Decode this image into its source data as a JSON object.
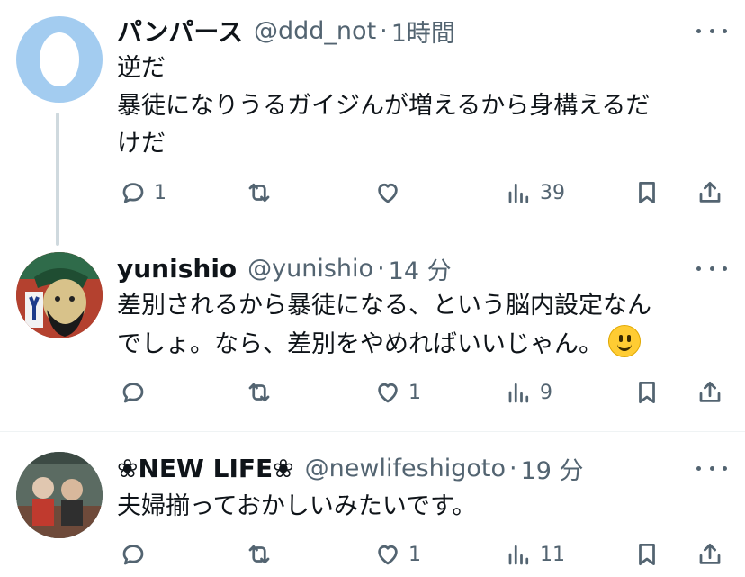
{
  "tweets": [
    {
      "name": "パンパース",
      "handle": "@ddd_not",
      "time": "1時間",
      "text": "逆だ\n暴徒になりうるガイジんが増えるから身構えるだ\nけだ",
      "replies": "1",
      "reposts": "",
      "likes": "",
      "views": "39",
      "avatar": "egg"
    },
    {
      "name": "yunishio",
      "handle": "@yunishio",
      "time": "14 分",
      "text": "差別されるから暴徒になる、という脳内設定なん\nでしょ。なら、差別をやめればいいじゃん。",
      "emoji": "slightly-smiling-face",
      "replies": "",
      "reposts": "",
      "likes": "1",
      "views": "9",
      "avatar": "illustration"
    },
    {
      "name": "❀NEW LIFE❀",
      "handle": "@newlifeshigoto",
      "time": "19 分",
      "text": "夫婦揃っておかしいみたいです。",
      "replies": "",
      "reposts": "",
      "likes": "1",
      "views": "11",
      "avatar": "photo"
    }
  ],
  "icons": {
    "reply": "reply-icon",
    "repost": "repost-icon",
    "like": "heart-icon",
    "views": "views-icon",
    "bookmark": "bookmark-icon",
    "share": "share-icon",
    "more": "more-icon"
  },
  "colors": {
    "secondary_text": "#536471",
    "thread_line": "#cfd9de",
    "egg_avatar_bg": "#a3ccf0"
  }
}
